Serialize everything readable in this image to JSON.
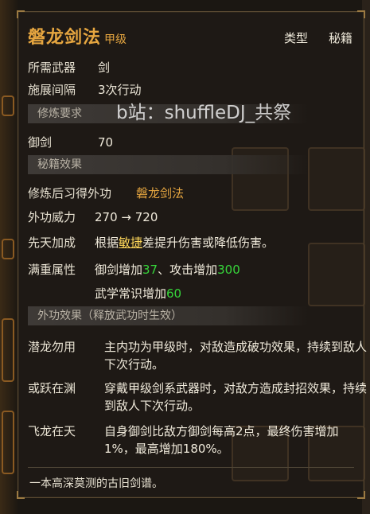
{
  "tooltip": {
    "title": "磐龙剑法",
    "grade": "甲级",
    "type_label": "类型",
    "type_value": "秘籍",
    "stats": {
      "weapon_label": "所需武器",
      "weapon_value": "剑",
      "interval_label": "施展间隔",
      "interval_value": "3次行动"
    },
    "sections": {
      "training": "修炼要求",
      "scroll_effect": "秘籍效果",
      "external_effect": "外功效果（释放武功时生效）"
    },
    "training": {
      "sword_label": "御剑",
      "sword_value": "70"
    },
    "scroll": {
      "learn_label": "修炼后习得外功",
      "learn_value": "磐龙剑法",
      "power_label": "外功威力",
      "power_value": "270 → 720",
      "innate_label": "先天加成",
      "innate_pre": "根据",
      "innate_hl": "敏捷",
      "innate_post": "差提升伤害或降低伤害。",
      "full_label": "满重属性",
      "full_line1_a": "御剑增加 ",
      "full_line1_b": "37",
      "full_line1_c": "、攻击增加 ",
      "full_line1_d": "300",
      "full_line2_a": "武学常识增加 ",
      "full_line2_b": "60"
    },
    "effects": [
      {
        "name": "潜龙勿用",
        "desc": "主内功为甲级时，对敌造成破功效果，持续到敌人下次行动。"
      },
      {
        "name": "或跃在渊",
        "desc": "穿戴甲级剑系武器时，对敌方造成封招效果，持续到敌人下次行动。"
      },
      {
        "name": "飞龙在天",
        "desc": "自身御剑比敌方御剑每高2点，最终伤害增加1%，最高增加180%。"
      }
    ],
    "flavor": "一本高深莫测的古旧剑谱。"
  },
  "watermark": "b站：shuffleDJ_共祭",
  "colors": {
    "gold": "#e6a640",
    "green": "#36d43a",
    "panel_bg": "#1e1a16"
  }
}
